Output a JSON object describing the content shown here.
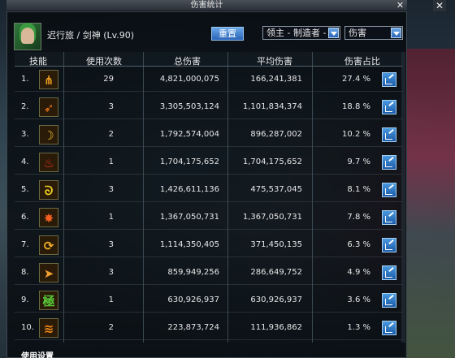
{
  "window": {
    "title": "伤害统计",
    "close_label": "✕"
  },
  "outer_close_label": "✕",
  "character": {
    "name": "迟行旅 / 剑神 (Lv.90)"
  },
  "controls": {
    "reset_label": "重置",
    "target_select": "领主 - 制造者 - 伊",
    "metric_select": "伤害"
  },
  "table": {
    "headers": {
      "skill": "技能",
      "uses": "使用次数",
      "total": "总伤害",
      "avg": "平均伤害",
      "pct": "伤害占比"
    },
    "rows": [
      {
        "idx": "1.",
        "icon": "slash-burst-icon",
        "color": "#f0a020",
        "uses": "29",
        "total": "4,821,000,075",
        "avg": "166,241,381",
        "pct": "27.4 %"
      },
      {
        "idx": "2.",
        "icon": "sword-wave-icon",
        "color": "#f07818",
        "uses": "3",
        "total": "3,305,503,124",
        "avg": "1,101,834,374",
        "pct": "18.8 %"
      },
      {
        "idx": "3.",
        "icon": "crescent-slash-icon",
        "color": "#f0c030",
        "uses": "2",
        "total": "1,792,574,004",
        "avg": "896,287,002",
        "pct": "10.2 %"
      },
      {
        "idx": "4.",
        "icon": "flame-wings-icon",
        "color": "#e83818",
        "uses": "1",
        "total": "1,704,175,652",
        "avg": "1,704,175,652",
        "pct": "9.7 %"
      },
      {
        "idx": "5.",
        "icon": "spiral-blade-icon",
        "color": "#f0d020",
        "uses": "3",
        "total": "1,426,611,136",
        "avg": "475,537,045",
        "pct": "8.1 %"
      },
      {
        "idx": "6.",
        "icon": "fan-strike-icon",
        "color": "#f06020",
        "uses": "1",
        "total": "1,367,050,731",
        "avg": "1,367,050,731",
        "pct": "7.8 %"
      },
      {
        "idx": "7.",
        "icon": "swirl-cut-icon",
        "color": "#f0b028",
        "uses": "3",
        "total": "1,114,350,405",
        "avg": "371,450,135",
        "pct": "6.3 %"
      },
      {
        "idx": "8.",
        "icon": "dash-arrow-icon",
        "color": "#f0a030",
        "uses": "3",
        "total": "859,949,256",
        "avg": "286,649,752",
        "pct": "4.9 %"
      },
      {
        "idx": "9.",
        "icon": "grass-kanji-icon",
        "color": "#58c838",
        "uses": "1",
        "total": "630,926,937",
        "avg": "630,926,937",
        "pct": "3.6 %"
      },
      {
        "idx": "10.",
        "icon": "double-slash-icon",
        "color": "#f08818",
        "uses": "2",
        "total": "223,873,724",
        "avg": "111,936,862",
        "pct": "1.3 %"
      }
    ]
  },
  "footer": {
    "label": "使用设置"
  }
}
